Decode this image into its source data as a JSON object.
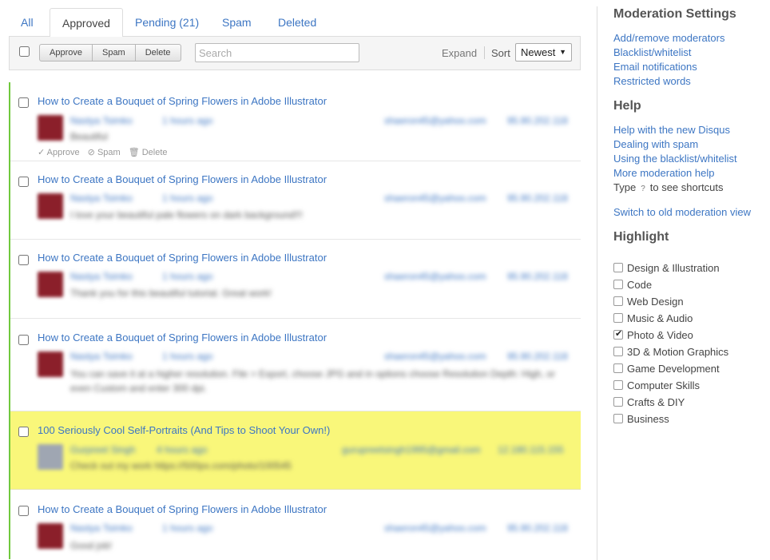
{
  "tabs": [
    {
      "label": "All"
    },
    {
      "label": "Approved"
    },
    {
      "label": "Pending (21)"
    },
    {
      "label": "Spam"
    },
    {
      "label": "Deleted"
    }
  ],
  "toolbar": {
    "approve_label": "Approve",
    "spam_label": "Spam",
    "delete_label": "Delete",
    "search_placeholder": "Search",
    "expand_label": "Expand",
    "sort_label": "Sort",
    "sort_value": "Newest"
  },
  "comments": [
    {
      "title": "How to Create a Bouquet of Spring Flowers in Adobe Illustrator",
      "author": "Nastya Tsimko",
      "time": "1 hours ago",
      "email": "shaeron45@yahoo.com",
      "ip": "95.90.202.118",
      "body": "Beautiful",
      "highlighted": false,
      "actions": {
        "approve": "Approve",
        "spam": "Spam",
        "delete": "Delete"
      }
    },
    {
      "title": "How to Create a Bouquet of Spring Flowers in Adobe Illustrator",
      "author": "Nastya Tsimko",
      "time": "1 hours ago",
      "email": "shaeron45@yahoo.com",
      "ip": "95.90.202.118",
      "body": "I love your beautiful pale flowers on dark background!!!",
      "highlighted": false
    },
    {
      "title": "How to Create a Bouquet of Spring Flowers in Adobe Illustrator",
      "author": "Nastya Tsimko",
      "time": "1 hours ago",
      "email": "shaeron45@yahoo.com",
      "ip": "95.90.202.118",
      "body": "Thank you for this beautiful tutorial. Great work!",
      "highlighted": false
    },
    {
      "title": "How to Create a Bouquet of Spring Flowers in Adobe Illustrator",
      "author": "Nastya Tsimko",
      "time": "1 hours ago",
      "email": "shaeron45@yahoo.com",
      "ip": "95.90.202.118",
      "body": "You can save it at a higher resolution. File > Export, choose JPG and in options choose Resolution Depth: High, or even Custom and enter 300 dpi.",
      "highlighted": false
    },
    {
      "title": "100 Seriously Cool Self-Portraits (And Tips to Shoot Your Own!)",
      "author": "Gurpreet Singh",
      "time": "4 hours ago",
      "email": "gurupreetsingh1995@gmail.com",
      "ip": "12.180.115.155",
      "body": "Check out my work https://500px.com/photo/100545",
      "highlighted": true
    },
    {
      "title": "How to Create a Bouquet of Spring Flowers in Adobe Illustrator",
      "author": "Nastya Tsimko",
      "time": "1 hours ago",
      "email": "shaeron45@yahoo.com",
      "ip": "95.90.202.118",
      "body": "Good job!",
      "highlighted": false
    }
  ],
  "sidebar": {
    "moderation_heading": "Moderation Settings",
    "moderation_links": [
      "Add/remove moderators",
      "Blacklist/whitelist",
      "Email notifications",
      "Restricted words"
    ],
    "help_heading": "Help",
    "help_links": [
      "Help with the new Disqus",
      "Dealing with spam",
      "Using the blacklist/whitelist",
      "More moderation help"
    ],
    "shortcut_prefix": "Type",
    "shortcut_key": "?",
    "shortcut_suffix": "to see shortcuts",
    "old_moderation_link": "Switch to old moderation view",
    "highlight_heading": "Highlight",
    "highlight_items": [
      {
        "label": "Design & Illustration",
        "checked": false
      },
      {
        "label": "Code",
        "checked": false
      },
      {
        "label": "Web Design",
        "checked": false
      },
      {
        "label": "Music & Audio",
        "checked": false
      },
      {
        "label": "Photo & Video",
        "checked": true
      },
      {
        "label": "3D & Motion Graphics",
        "checked": false
      },
      {
        "label": "Game Development",
        "checked": false
      },
      {
        "label": "Computer Skills",
        "checked": false
      },
      {
        "label": "Crafts & DIY",
        "checked": false
      },
      {
        "label": "Business",
        "checked": false
      }
    ]
  },
  "colors": {
    "link": "#3d76c3",
    "highlight": "#f9f77a",
    "approved_bar": "#70c83d"
  }
}
